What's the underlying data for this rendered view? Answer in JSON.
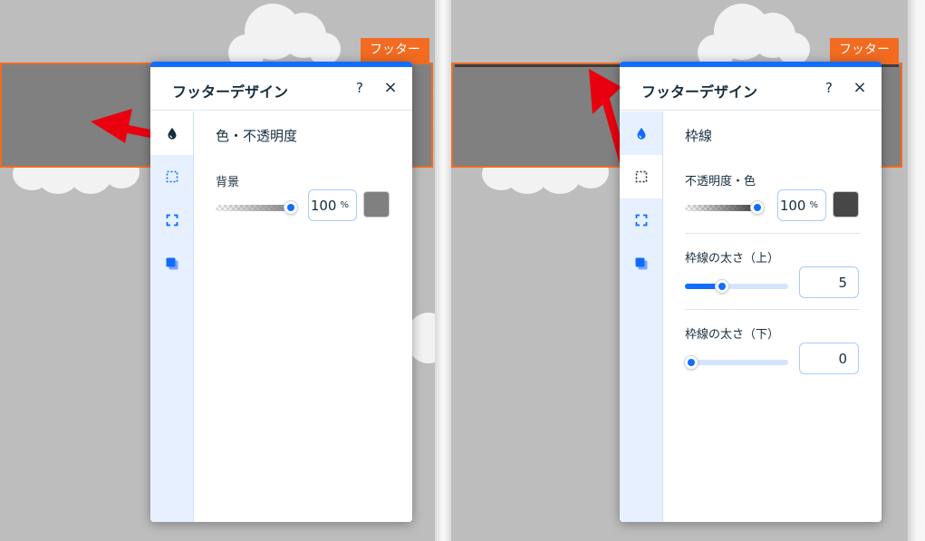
{
  "colors": {
    "accent": "#116dff",
    "footer_outline": "#f26b21",
    "arrow": "#e8000f",
    "left_swatch": "#808080",
    "right_swatch": "#474747"
  },
  "left": {
    "footer_tag": "フッター",
    "panel": {
      "title": "フッターデザイン",
      "help": "?",
      "close": "×",
      "section_title": "色・不透明度",
      "bg_label": "背景",
      "opacity_value": "100",
      "opacity_unit": "%",
      "opacity_level": 1.0,
      "active_tab": "fill"
    }
  },
  "right": {
    "footer_tag": "フッター",
    "panel": {
      "title": "フッターデザイン",
      "help": "?",
      "close": "×",
      "section_title": "枠線",
      "opacity_label": "不透明度・色",
      "opacity_value": "100",
      "opacity_unit": "%",
      "opacity_level": 1.0,
      "top_label": "枠線の太さ（上）",
      "top_value": "5",
      "top_level": 0.36,
      "bottom_label": "枠線の太さ（下）",
      "bottom_value": "0",
      "bottom_level": 0.0,
      "active_tab": "border"
    }
  },
  "nav_icons": [
    "fill-drop-icon",
    "border-icon",
    "corners-icon",
    "shadow-icon"
  ]
}
